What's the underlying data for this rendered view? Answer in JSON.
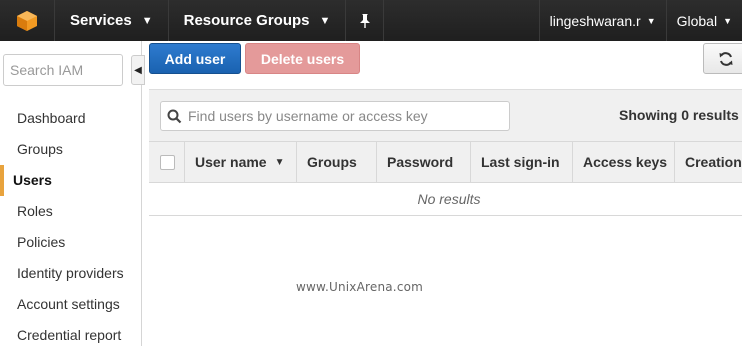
{
  "topnav": {
    "services_label": "Services",
    "resource_groups_label": "Resource Groups",
    "user_label": "lingeshwaran.r",
    "region_label": "Global"
  },
  "sidebar": {
    "search_placeholder": "Search IAM",
    "items": [
      {
        "label": "Dashboard"
      },
      {
        "label": "Groups"
      },
      {
        "label": "Users",
        "active": true
      },
      {
        "label": "Roles"
      },
      {
        "label": "Policies"
      },
      {
        "label": "Identity providers"
      },
      {
        "label": "Account settings"
      },
      {
        "label": "Credential report"
      }
    ]
  },
  "toolbar": {
    "add_user_label": "Add user",
    "delete_users_label": "Delete users"
  },
  "filter": {
    "placeholder": "Find users by username or access key",
    "showing_text": "Showing 0 results"
  },
  "table": {
    "columns": [
      "User name",
      "Groups",
      "Password",
      "Last sign-in",
      "Access keys",
      "Creation"
    ],
    "empty_text": "No results"
  },
  "watermark": "www.UnixArena.com",
  "colors": {
    "nav_bg": "#232323",
    "primary_button": "#1f6bbf",
    "delete_button": "#e49a9a",
    "active_marker": "#e8a33d"
  }
}
